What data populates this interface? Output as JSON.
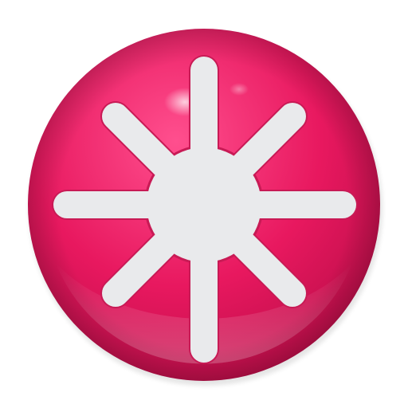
{
  "app_icon": {
    "icon": "sunburst-asterisk-icon",
    "colors": {
      "background": "#ffffff",
      "sphere_base": "#e8185f",
      "sphere_light": "#ff4f8e",
      "sphere_dark": "#b80d47",
      "emblem": "#e9eaec",
      "emblem_outline": "#c81a55"
    }
  }
}
